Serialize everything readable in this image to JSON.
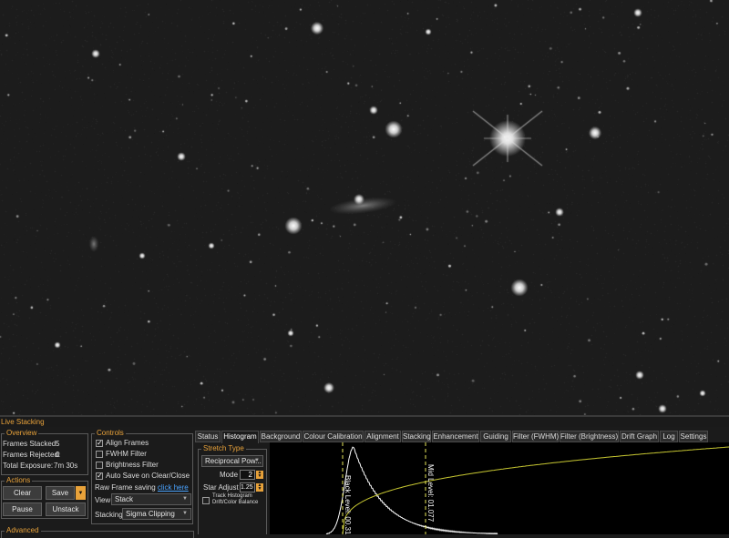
{
  "window": {
    "title": "Live Stacking"
  },
  "overview": {
    "legend": "Overview",
    "frames_stacked_label": "Frames Stacked:",
    "frames_stacked_value": "5",
    "frames_rejected_label": "Frames Rejected:",
    "frames_rejected_value": "0",
    "total_exposure_label": "Total Exposure:",
    "total_exposure_value": "7m 30s"
  },
  "actions": {
    "legend": "Actions",
    "clear": "Clear",
    "save": "Save",
    "pause": "Pause",
    "unstack": "Unstack"
  },
  "advanced": {
    "legend": "Advanced"
  },
  "controls": {
    "legend": "Controls",
    "align_frames": {
      "label": "Align Frames",
      "checked": true
    },
    "fwhm_filter": {
      "label": "FWHM Filter",
      "checked": false
    },
    "brightness_filter": {
      "label": "Brightness Filter",
      "checked": false
    },
    "auto_save": {
      "label": "Auto Save on Clear/Close",
      "checked": true
    },
    "raw_frame_label": "Raw Frame saving",
    "raw_frame_link": "click here",
    "view_label": "View",
    "view_value": "Stack",
    "stacking_label": "Stacking",
    "stacking_value": "Sigma Clipping"
  },
  "tabs": [
    "Status",
    "Histogram",
    "Background",
    "Colour Calibration",
    "Alignment",
    "Stacking",
    "Enhancement",
    "Guiding",
    "Filter (FWHM)",
    "Filter (Brightness)",
    "Drift Graph",
    "Log",
    "Settings"
  ],
  "active_tab": "Histogram",
  "stretch": {
    "legend": "Stretch Type",
    "type_value": "Reciprocal Pow...",
    "mode_label": "Mode",
    "mode_value": "2",
    "star_adjust_label": "Star Adjust",
    "star_adjust_value": "1.25",
    "track_label_1": "Track Histogram",
    "track_label_2": "Drift/Color Balance"
  },
  "histogram": {
    "black_level_label": "Black Level: 00.312",
    "mid_level_label": "Mid Level: 01.077"
  },
  "colors": {
    "accent": "#e8a23a",
    "link": "#4aa3ff",
    "curve": "#c8c832"
  }
}
